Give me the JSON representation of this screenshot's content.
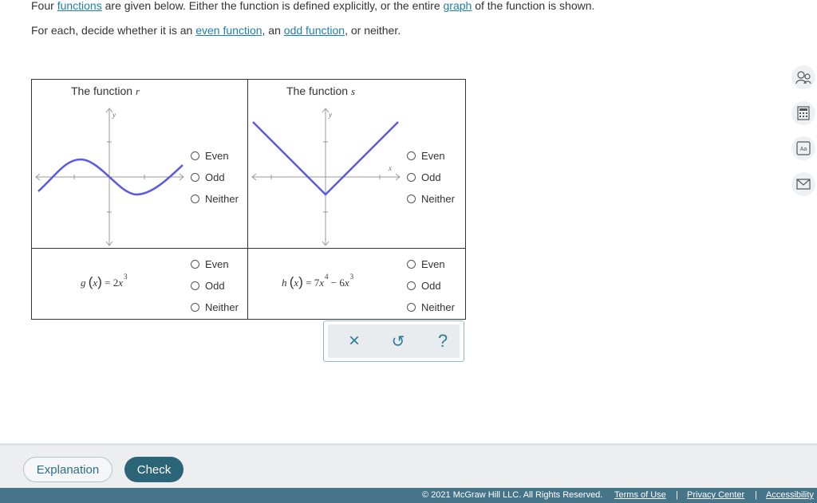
{
  "prompt": {
    "line1": {
      "p1": "Four ",
      "link1": "functions",
      "p2": " are given below. Either the function is defined explicitly, or the entire ",
      "link2": "graph",
      "p3": " of the function is shown."
    },
    "line2": {
      "p1": "For each, decide whether it is an ",
      "link1": "even function",
      "p2": ", an ",
      "link2": "odd function",
      "p3": ", or neither."
    }
  },
  "cells": {
    "r": {
      "title": "The function ",
      "var": "r",
      "y_label": "y"
    },
    "s": {
      "title": "The function ",
      "var": "s",
      "y_label": "y",
      "x_label": "x"
    }
  },
  "formulas": {
    "g": {
      "name": "g",
      "lp": "(",
      "arg": "x",
      "rp": ")",
      "eq": " = 2",
      "var": "x",
      "exp": "3"
    },
    "h": {
      "name": "h",
      "lp": "(",
      "arg": "x",
      "rp": ")",
      "eq": " = 7",
      "var1": "x",
      "exp1": "4",
      "minus": " − 6",
      "var2": "x",
      "exp2": "3"
    }
  },
  "options": {
    "even": "Even",
    "odd": "Odd",
    "neither": "Neither"
  },
  "toolbar": {
    "clear": "×",
    "undo": "↺",
    "help": "?"
  },
  "side_icons": [
    "tutor-icon",
    "calculator-icon",
    "glossary-icon",
    "message-icon"
  ],
  "side_labels": {
    "glossary": "Aa"
  },
  "buttons": {
    "explanation": "Explanation",
    "check": "Check"
  },
  "footer": {
    "copyright": "© 2021 McGraw Hill LLC. All Rights Reserved.",
    "terms": "Terms of Use",
    "privacy": "Privacy Center",
    "accessibility": "Accessibility",
    "sep": "|"
  },
  "colors": {
    "link": "#1f7fa6",
    "curve": "#5a5adf",
    "check_button": "#2c6478",
    "footer": "#467489"
  }
}
